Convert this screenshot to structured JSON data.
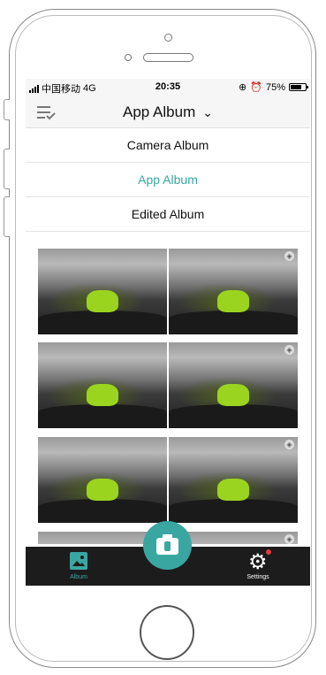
{
  "status": {
    "carrier": "中国移动",
    "network": "4G",
    "time": "20:35",
    "battery_pct": "75%",
    "battery_level": 0.75
  },
  "nav": {
    "title": "App Album",
    "chevron": "chevron-down-icon",
    "menu_icon": "list-check-icon"
  },
  "dropdown": {
    "items": [
      {
        "label": "Camera Album",
        "active": false
      },
      {
        "label": "App Album",
        "active": true
      },
      {
        "label": "Edited Album",
        "active": false
      }
    ]
  },
  "gallery": {
    "rows": 4,
    "items_per_row": 2,
    "badge_icon": "panorama-cube-icon"
  },
  "tabbar": {
    "album_label": "Album",
    "settings_label": "Settings",
    "settings_badge": "notification-dot"
  },
  "colors": {
    "accent": "#3aa6a1",
    "tabbar_bg": "#1c1c1c",
    "badge": "#e23b3b"
  }
}
